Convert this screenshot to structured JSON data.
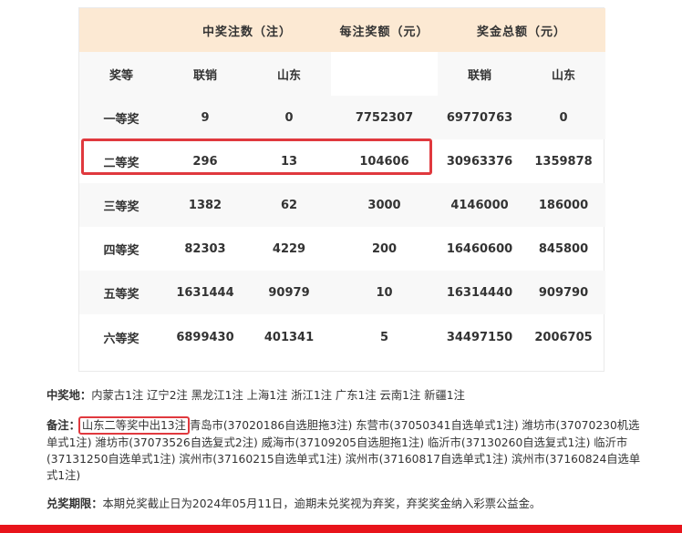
{
  "table": {
    "header": {
      "winning_count": "中奖注数（注）",
      "per_prize": "每注奖额（元）",
      "total_prize": "奖金总额（元）"
    },
    "subheader": {
      "level": "奖等",
      "national": "联销",
      "shandong": "山东",
      "total_national": "联销",
      "total_shandong": "山东"
    },
    "rows": [
      {
        "level": "一等奖",
        "national": "9",
        "shandong": "0",
        "per": "7752307",
        "total_national": "69770763",
        "total_shandong": "0"
      },
      {
        "level": "二等奖",
        "national": "296",
        "shandong": "13",
        "per": "104606",
        "total_national": "30963376",
        "total_shandong": "1359878"
      },
      {
        "level": "三等奖",
        "national": "1382",
        "shandong": "62",
        "per": "3000",
        "total_national": "4146000",
        "total_shandong": "186000"
      },
      {
        "level": "四等奖",
        "national": "82303",
        "shandong": "4229",
        "per": "200",
        "total_national": "16460600",
        "total_shandong": "845800"
      },
      {
        "level": "五等奖",
        "national": "1631444",
        "shandong": "90979",
        "per": "10",
        "total_national": "16314440",
        "total_shandong": "909790"
      },
      {
        "level": "六等奖",
        "national": "6899430",
        "shandong": "401341",
        "per": "5",
        "total_national": "34497150",
        "total_shandong": "2006705"
      }
    ]
  },
  "notes": {
    "location_label": "中奖地：",
    "location_text": "内蒙古1注 辽宁2注 黑龙江1注 上海1注 浙江1注 广东1注 云南1注 新疆1注",
    "remark_label": "备注：",
    "remark_highlight": "山东二等奖中出13注",
    "remark_text": "青岛市(37020186自选胆拖3注) 东营市(37050341自选单式1注) 潍坊市(37070230机选单式1注) 潍坊市(37073526自选复式2注) 威海市(37109205自选胆拖1注) 临沂市(37130260自选复式1注) 临沂市(37131250自选单式1注) 滨州市(37160215自选单式1注) 滨州市(37160817自选单式1注) 滨州市(37160824自选单式1注)",
    "deadline_label": "兑奖期限：",
    "deadline_text": "本期兑奖截止日为2024年05月11日，逾期未兑奖视为弃奖，弃奖奖金纳入彩票公益金。"
  },
  "colors": {
    "header_bg": "#fce9d3",
    "highlight_border": "#e0393e",
    "bottom_bar": "#e8141b"
  }
}
